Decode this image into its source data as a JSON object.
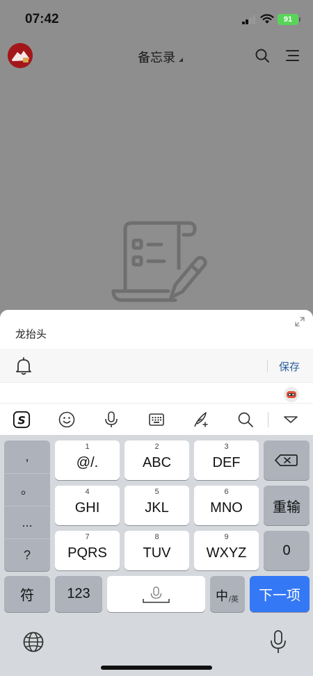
{
  "status": {
    "time": "07:42",
    "battery": "91"
  },
  "header": {
    "title": "备忘录"
  },
  "sheet": {
    "note_text": "龙抬头",
    "save_label": "保存"
  },
  "keyboard": {
    "punctuation": [
      ",",
      "。",
      "...",
      "?"
    ],
    "rows": [
      [
        {
          "num": "1",
          "label": "@/."
        },
        {
          "num": "2",
          "label": "ABC"
        },
        {
          "num": "3",
          "label": "DEF"
        }
      ],
      [
        {
          "num": "4",
          "label": "GHI"
        },
        {
          "num": "5",
          "label": "JKL"
        },
        {
          "num": "6",
          "label": "MNO"
        }
      ],
      [
        {
          "num": "7",
          "label": "PQRS"
        },
        {
          "num": "8",
          "label": "TUV"
        },
        {
          "num": "9",
          "label": "WXYZ"
        }
      ]
    ],
    "reenter_label": "重输",
    "zero_label": "0",
    "symbol_label": "符",
    "numbers_label": "123",
    "lang_main": "中",
    "lang_sub": "/英",
    "next_label": "下一项"
  }
}
